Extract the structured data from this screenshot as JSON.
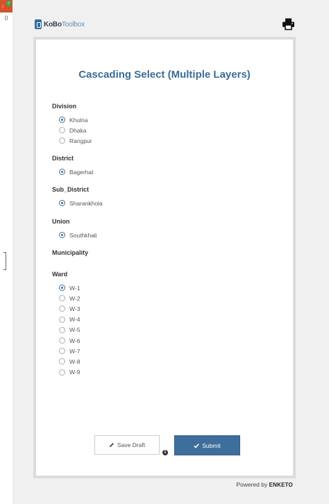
{
  "sidebar": {
    "count": "0"
  },
  "header": {
    "logo_part1": "KoBo",
    "logo_part2": "Toolbox",
    "print_icon": "print-icon"
  },
  "form": {
    "title": "Cascading Select (Multiple Layers)",
    "questions": [
      {
        "label": "Division",
        "options": [
          {
            "label": "Khulna",
            "checked": true
          },
          {
            "label": "Dhaka",
            "checked": false
          },
          {
            "label": "Rangpur",
            "checked": false
          }
        ]
      },
      {
        "label": "District",
        "options": [
          {
            "label": "Bagerhat",
            "checked": true
          }
        ]
      },
      {
        "label": "Sub_District",
        "options": [
          {
            "label": "Sharankhola",
            "checked": true
          }
        ]
      },
      {
        "label": "Union",
        "options": [
          {
            "label": "Southkhali",
            "checked": true
          }
        ]
      },
      {
        "label": "Municipality",
        "options": []
      },
      {
        "label": "Ward",
        "options": [
          {
            "label": "W-1",
            "checked": true
          },
          {
            "label": "W-2",
            "checked": false
          },
          {
            "label": "W-3",
            "checked": false
          },
          {
            "label": "W-4",
            "checked": false
          },
          {
            "label": "W-5",
            "checked": false
          },
          {
            "label": "W-6",
            "checked": false
          },
          {
            "label": "W-7",
            "checked": false
          },
          {
            "label": "W-8",
            "checked": false
          },
          {
            "label": "W-9",
            "checked": false
          }
        ]
      }
    ]
  },
  "actions": {
    "save_draft_label": "Save Draft",
    "submit_label": "Submit"
  },
  "footer": {
    "powered_by": "Powered by",
    "brand": "ENKETO"
  },
  "colors": {
    "accent": "#3e6e9c",
    "title": "#3b6d98",
    "background": "#f0f0f0"
  }
}
